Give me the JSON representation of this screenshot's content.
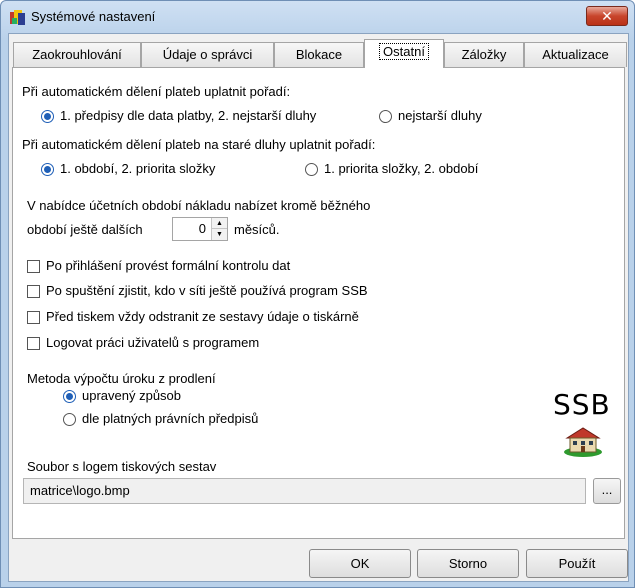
{
  "window": {
    "title": "Systémové nastavení",
    "close_glyph": "✕"
  },
  "tabs": [
    {
      "label": "Zaokrouhlování"
    },
    {
      "label": "Údaje o správci"
    },
    {
      "label": "Blokace"
    },
    {
      "label": "Ostatní"
    },
    {
      "label": "Záložky"
    },
    {
      "label": "Aktualizace"
    }
  ],
  "active_tab": "Ostatní",
  "payment_order": {
    "label": "Při automatickém dělení plateb uplatnit pořadí:",
    "options": [
      {
        "label": "1. předpisy dle data platby, 2. nejstarší dluhy",
        "selected": true
      },
      {
        "label": "nejstarší dluhy",
        "selected": false
      }
    ]
  },
  "old_debt_order": {
    "label": "Při automatickém dělení plateb na staré dluhy uplatnit pořadí:",
    "options": [
      {
        "label": "1. období, 2. priorita složky",
        "selected": true
      },
      {
        "label": "1. priorita složky, 2. období",
        "selected": false
      }
    ]
  },
  "periods": {
    "line1": "V nabídce účetních období nákladu nabízet kromě běžného",
    "line2_before": "období ještě dalších",
    "value": "0",
    "line2_after": "měsíců."
  },
  "checkboxes": [
    {
      "label": "Po přihlášení provést formální kontrolu dat",
      "checked": false
    },
    {
      "label": "Po spuštění zjistit, kdo v síti ještě používá program SSB",
      "checked": false
    },
    {
      "label": "Před tiskem vždy odstranit ze sestavy údaje o tiskárně",
      "checked": false
    },
    {
      "label": "Logovat práci uživatelů s programem",
      "checked": false
    }
  ],
  "interest_method": {
    "label": "Metoda výpočtu úroku z prodlení",
    "options": [
      {
        "label": "upravený způsob",
        "selected": true
      },
      {
        "label": "dle platných právních předpisů",
        "selected": false
      }
    ]
  },
  "logo": {
    "text": "SSB"
  },
  "logo_file": {
    "label": "Soubor s logem tiskových sestav",
    "value": "matrice\\logo.bmp",
    "browse_label": "..."
  },
  "buttons": {
    "ok": "OK",
    "cancel": "Storno",
    "apply": "Použít"
  },
  "colors": {
    "accent": "#1f5fb7",
    "close": "#c8452c"
  }
}
